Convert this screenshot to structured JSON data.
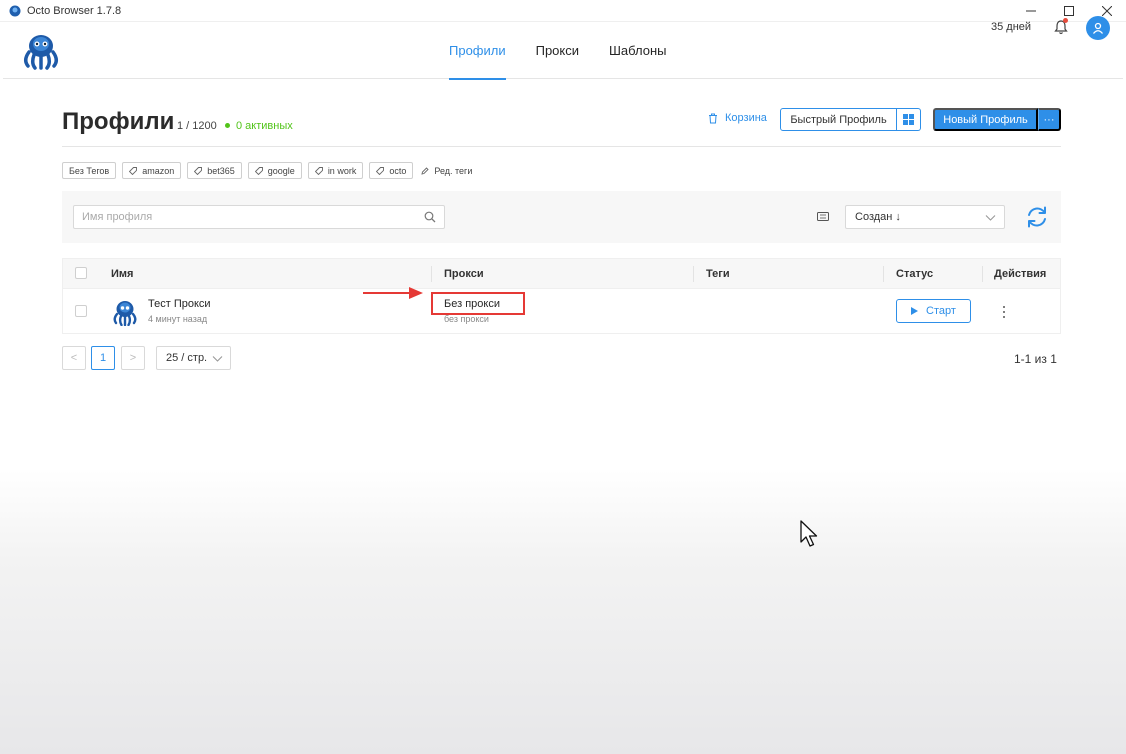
{
  "window": {
    "title": "Octo Browser 1.7.8"
  },
  "header": {
    "nav": [
      {
        "label": "Профили",
        "active": true
      },
      {
        "label": "Прокси",
        "active": false
      },
      {
        "label": "Шаблоны",
        "active": false
      }
    ],
    "days_left": "35 дней"
  },
  "page": {
    "title": "Профили",
    "count": "1 / 1200",
    "active_text": "0 активных",
    "trash_label": "Корзина",
    "quick_profile_label": "Быстрый Профиль",
    "new_profile_label": "Новый Профиль",
    "new_profile_more": "···"
  },
  "tags": {
    "no_tags": "Без Тегов",
    "items": [
      "amazon",
      "bet365",
      "google",
      "in work",
      "octo"
    ],
    "edit_label": "Ред. теги"
  },
  "filters": {
    "search_placeholder": "Имя профиля",
    "sort_label": "Создан ↓"
  },
  "table": {
    "headers": {
      "name": "Имя",
      "proxy": "Прокси",
      "tags": "Теги",
      "status": "Статус",
      "actions": "Действия"
    },
    "rows": [
      {
        "name": "Тест Прокси",
        "created": "4 минут назад",
        "proxy": "Без прокси",
        "proxy_sub": "без прокси",
        "start_label": "Старт"
      }
    ]
  },
  "pagination": {
    "prev": "<",
    "current_page": "1",
    "next": ">",
    "per_page": "25 / стр.",
    "range": "1-1 из 1"
  },
  "colors": {
    "accent": "#2e8fe8",
    "active_green": "#52c41a",
    "highlight_red": "#e53935"
  },
  "icons": [
    "app-icon",
    "minimize-icon",
    "maximize-icon",
    "close-icon",
    "octopus-logo",
    "bell-icon",
    "user-icon",
    "trash-icon",
    "windows-icon",
    "tag-icon",
    "edit-icon",
    "search-icon",
    "keyboard-icon",
    "chevron-down-icon",
    "refresh-icon",
    "play-icon",
    "more-vertical-icon",
    "mouse-cursor-icon",
    "annotation-arrow"
  ]
}
